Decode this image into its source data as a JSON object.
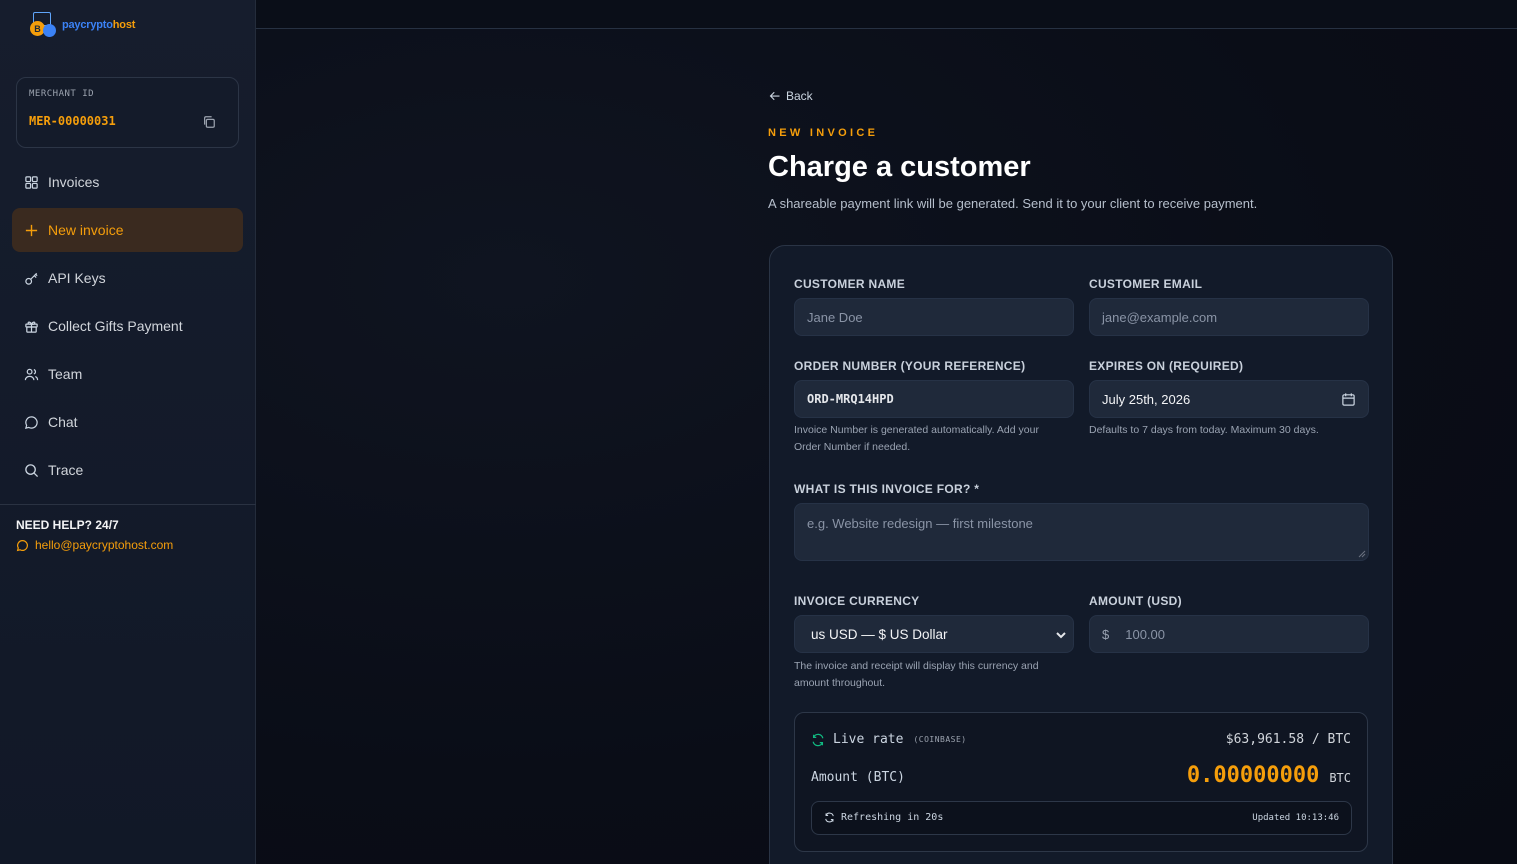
{
  "brand": {
    "name_part1": "paycrypto",
    "name_part2": "host"
  },
  "merchant": {
    "label": "MERCHANT ID",
    "id": "MER-00000031"
  },
  "nav": [
    {
      "label": "Invoices",
      "icon": "grid-icon",
      "active": false
    },
    {
      "label": "New invoice",
      "icon": "plus-icon",
      "active": true
    },
    {
      "label": "API Keys",
      "icon": "key-icon",
      "active": false
    },
    {
      "label": "Collect Gifts Payment",
      "icon": "gift-icon",
      "active": false
    },
    {
      "label": "Team",
      "icon": "users-icon",
      "active": false
    },
    {
      "label": "Chat",
      "icon": "chat-icon",
      "active": false
    },
    {
      "label": "Trace",
      "icon": "search-icon",
      "active": false
    }
  ],
  "help": {
    "title": "NEED HELP? 24/7",
    "email": "hello@paycryptohost.com"
  },
  "page": {
    "back": "Back",
    "eyebrow": "NEW INVOICE",
    "title": "Charge a customer",
    "subtitle": "A shareable payment link will be generated. Send it to your client to receive payment."
  },
  "form": {
    "customer_name": {
      "label": "CUSTOMER NAME",
      "placeholder": "Jane Doe"
    },
    "customer_email": {
      "label": "CUSTOMER EMAIL",
      "placeholder": "jane@example.com"
    },
    "order_number": {
      "label": "ORDER NUMBER (YOUR REFERENCE)",
      "value": "ORD-MRQ14HPD",
      "hint_line1": "Invoice Number is generated automatically. Add your",
      "hint_line2": "Order Number if needed."
    },
    "expires_on": {
      "label": "EXPIRES ON (REQUIRED)",
      "value": "July 25th, 2026",
      "hint": "Defaults to 7 days from today. Maximum 30 days."
    },
    "description": {
      "label": "WHAT IS THIS INVOICE FOR? *",
      "placeholder": "e.g. Website redesign — first milestone"
    },
    "currency": {
      "label": "INVOICE CURRENCY",
      "value": "us USD — $ US Dollar",
      "hint_line1": "The invoice and receipt will display this currency and",
      "hint_line2": "amount throughout."
    },
    "amount": {
      "label": "AMOUNT (USD)",
      "prefix": "$",
      "placeholder": "100.00"
    }
  },
  "rate": {
    "label": "Live rate",
    "source": "(COINBASE)",
    "price": "$63,961.58 / BTC",
    "amount_label": "Amount (BTC)",
    "amount_value": "0.00000000",
    "amount_unit": "BTC",
    "refreshing": "Refreshing in 20s",
    "updated": "Updated 10:13:46"
  },
  "colors": {
    "accent": "#f59e0b",
    "background": "#0b0f1a",
    "sidebar": "#131a28",
    "input": "#1f293a",
    "live_icon": "#10b981"
  }
}
